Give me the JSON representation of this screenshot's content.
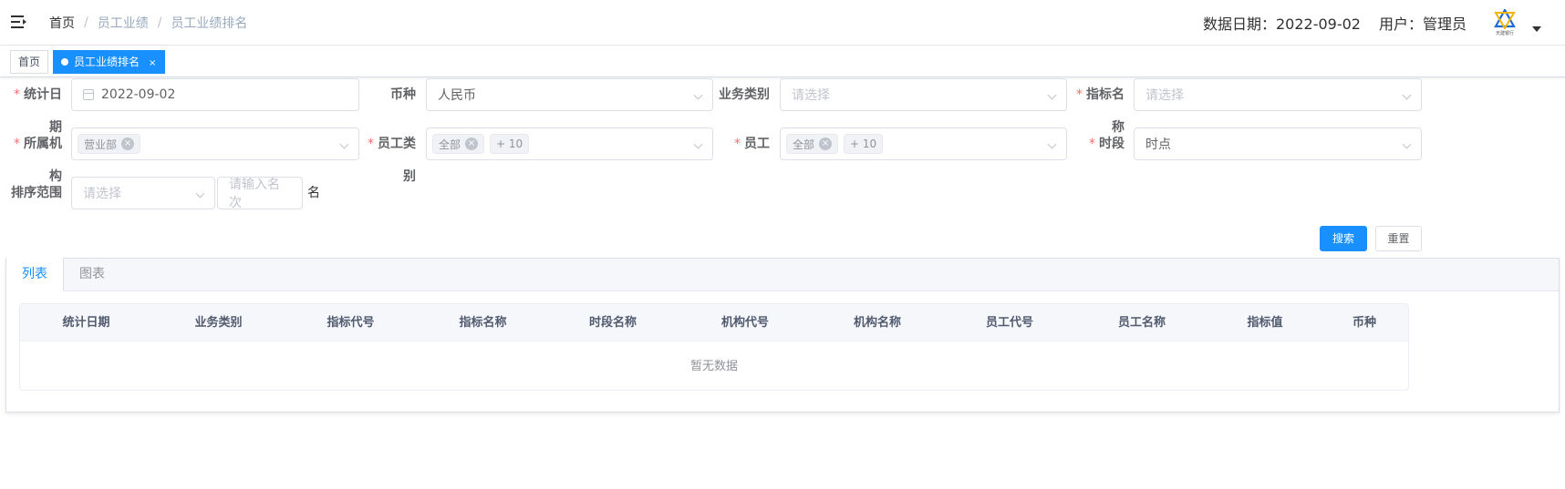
{
  "header": {
    "breadcrumb": [
      "首页",
      "员工业绩",
      "员工业绩排名"
    ],
    "data_date": "数据日期：2022-09-02",
    "user": "用户：管理员",
    "logo_caption": "天建银行"
  },
  "tags": {
    "home": "首页",
    "active": "员工业绩排名",
    "close": "×"
  },
  "form": {
    "stat_date": {
      "label": "统计日期",
      "value": "2022-09-02"
    },
    "currency": {
      "label": "币种",
      "value": "人民币"
    },
    "business_type": {
      "label": "业务类别",
      "placeholder": "请选择"
    },
    "indicator_name": {
      "label": "指标名称",
      "placeholder": "请选择"
    },
    "org": {
      "label": "所属机构",
      "chip": "营业部"
    },
    "employee_type": {
      "label": "员工类别",
      "chip": "全部",
      "more": "+ 10"
    },
    "employee": {
      "label": "员工",
      "chip": "全部",
      "more": "+ 10"
    },
    "period": {
      "label": "时段",
      "value": "时点"
    },
    "rank_range": {
      "label": "排序范围",
      "placeholder": "请选择",
      "count_placeholder": "请输入名次",
      "suffix": "名"
    }
  },
  "buttons": {
    "search": "搜索",
    "reset": "重置"
  },
  "tabs": {
    "list": "列表",
    "chart": "图表"
  },
  "table": {
    "columns": [
      "统计日期",
      "业务类别",
      "指标代号",
      "指标名称",
      "时段名称",
      "机构代号",
      "机构名称",
      "员工代号",
      "员工名称",
      "指标值",
      "币种"
    ],
    "empty_text": "暂无数据"
  },
  "colors": {
    "primary": "#1890ff",
    "required": "#f56c6c"
  }
}
